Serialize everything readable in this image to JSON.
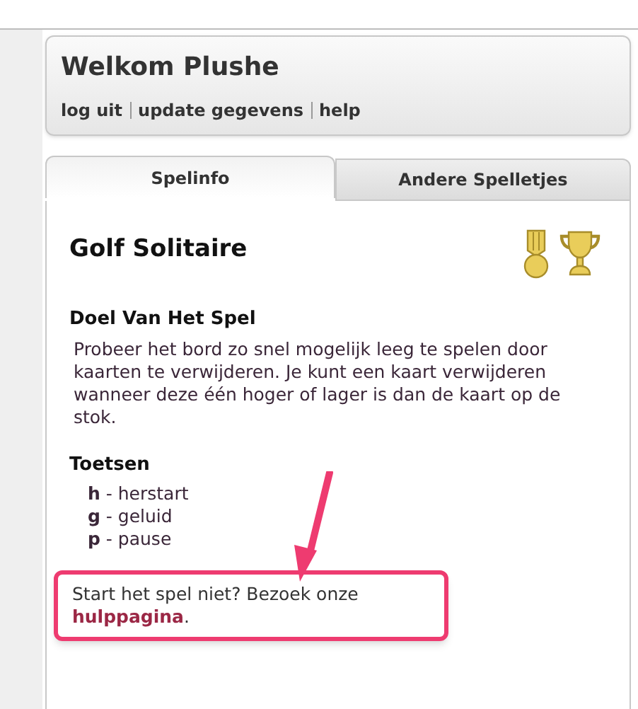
{
  "header": {
    "title": "Welkom Plushe",
    "links": [
      {
        "label": "log uit"
      },
      {
        "label": "update gegevens"
      },
      {
        "label": "help"
      }
    ]
  },
  "tabs": [
    {
      "label": "Spelinfo",
      "selected": true
    },
    {
      "label": "Andere Spelletjes",
      "selected": false
    }
  ],
  "game": {
    "title": "Golf Solitaire",
    "goal_heading": "Doel Van Het Spel",
    "goal_text": "Probeer het bord zo snel mogelijk leeg te spelen door kaarten te verwijderen. Je kunt een kaart verwijderen wanneer deze één hoger of lager is dan de kaart op de stok.",
    "keys_heading": "Toetsen",
    "keys": [
      "**h** - herstart",
      "**g** - geluid",
      "**p** - pause"
    ],
    "help": {
      "text": "Start het spel niet? Bezoek onze",
      "link": "hulppagina",
      "suffix": "."
    }
  }
}
